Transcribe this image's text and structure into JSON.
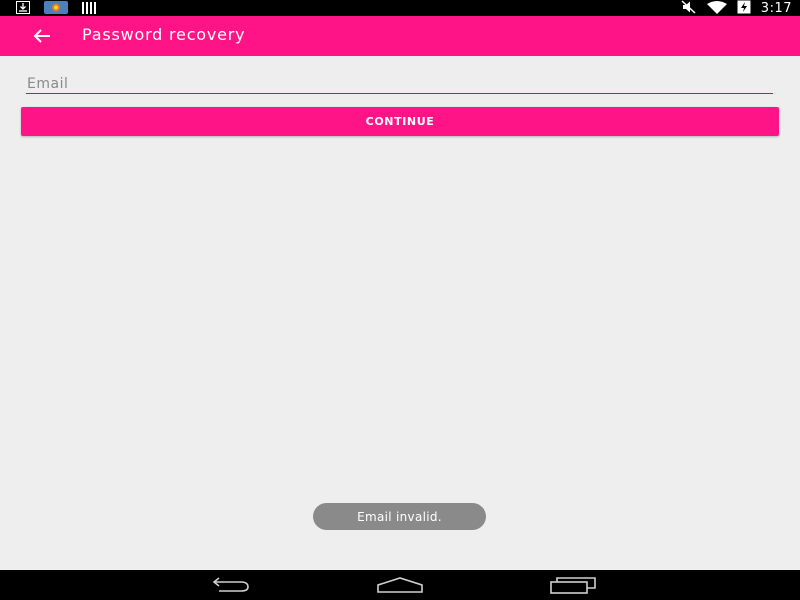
{
  "status_bar": {
    "time": "3:17",
    "left_icons": [
      "download-icon",
      "app-notification-icon",
      "barcode-icon"
    ],
    "right_icons": [
      "mute-icon",
      "wifi-icon",
      "battery-charging-icon"
    ]
  },
  "toolbar": {
    "title": "Password recovery",
    "back_icon": "back-arrow-icon",
    "color": "#ff1487"
  },
  "form": {
    "email": {
      "placeholder": "Email",
      "value": ""
    },
    "continue_label": "CONTINUE"
  },
  "toast": {
    "message": "Email invalid."
  },
  "nav_bar": {
    "buttons": [
      "back-icon",
      "home-icon",
      "recents-icon"
    ]
  },
  "colors": {
    "accent": "#ff1487",
    "background": "#eeeeee",
    "toast": "#8a8a8a"
  }
}
